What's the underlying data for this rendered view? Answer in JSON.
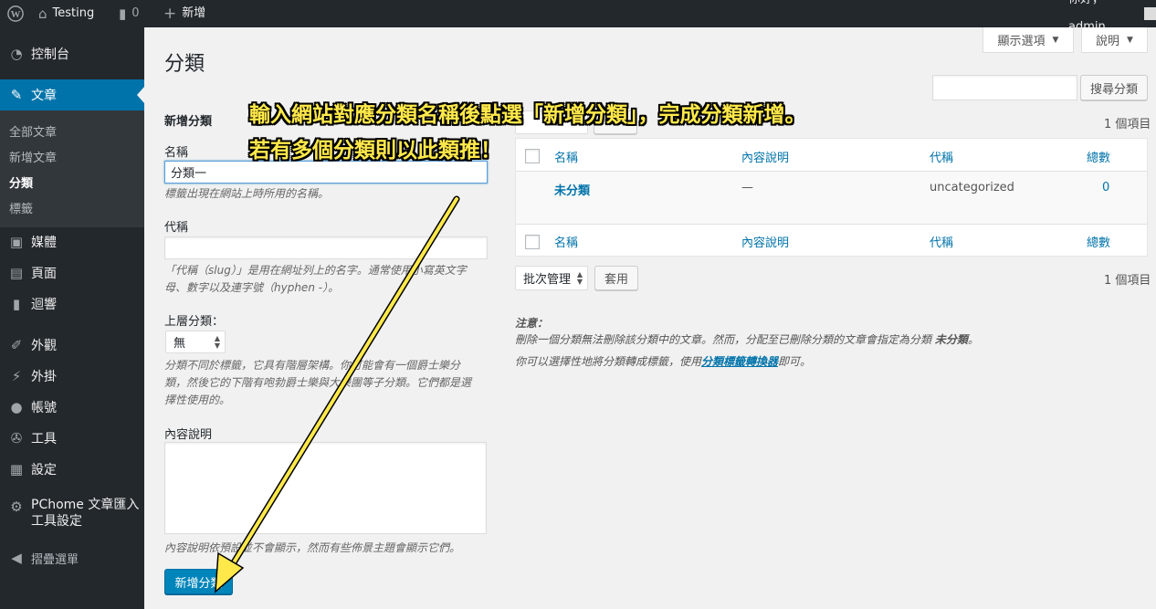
{
  "adminbar": {
    "site_name": "Testing",
    "comments_count": "0",
    "new_label": "新增",
    "greeting": "你好，admin"
  },
  "sidebar": {
    "items": [
      {
        "label": "控制台",
        "icon": "dashboard-icon"
      },
      {
        "label": "文章",
        "icon": "pin-icon"
      },
      {
        "label": "媒體",
        "icon": "media-icon"
      },
      {
        "label": "頁面",
        "icon": "page-icon"
      },
      {
        "label": "迴響",
        "icon": "comment-icon"
      },
      {
        "label": "外觀",
        "icon": "brush-icon"
      },
      {
        "label": "外掛",
        "icon": "plugin-icon"
      },
      {
        "label": "帳號",
        "icon": "user-icon"
      },
      {
        "label": "工具",
        "icon": "wrench-icon"
      },
      {
        "label": "設定",
        "icon": "settings-icon"
      },
      {
        "label": "PChome 文章匯入",
        "label2": "工具設定",
        "icon": "gear-icon"
      },
      {
        "label": "摺疊選單",
        "icon": "collapse-icon"
      }
    ],
    "submenu": [
      "全部文章",
      "新增文章",
      "分類",
      "標籤"
    ]
  },
  "screen_options": {
    "display_label": "顯示選項",
    "help_label": "說明"
  },
  "page_title": "分類",
  "search": {
    "value": "",
    "button_label": "搜尋分類"
  },
  "form": {
    "heading": "新增分類",
    "name_label": "名稱",
    "name_value": "分類一",
    "name_desc": "標籤出現在網站上時所用的名稱。",
    "slug_label": "代稱",
    "slug_value": "",
    "slug_desc_1": "「代稱（slug）」是用在網址列上的名字。通常使用小寫英文字",
    "slug_desc_2": "母、數字以及連字號（hyphen -）。",
    "parent_label": "上層分類：",
    "parent_value": "無",
    "parent_desc_1": "分類不同於標籤，它具有階層架構。你可能會有一個爵士樂分",
    "parent_desc_2": "類，然後它的下階有咆勃爵士樂與大樂團等子分類。它們都是選",
    "parent_desc_3": "擇性使用的。",
    "desc_label": "內容說明",
    "desc_value": "",
    "desc_desc": "內容說明依預設並不會顯示，然而有些佈景主題會顯示它們。",
    "submit_label": "新增分類"
  },
  "list": {
    "count_top": "1 個項目",
    "count_bottom": "1 個項目",
    "bulk_label": "批次管理",
    "apply_label": "套用",
    "columns": [
      "名稱",
      "內容說明",
      "代稱",
      "總數"
    ],
    "rows": [
      {
        "name": "未分類",
        "description": "—",
        "slug": "uncategorized",
        "count": "0"
      }
    ]
  },
  "notes": {
    "title": "注意：",
    "line1": "刪除一個分類無法刪除該分類中的文章。然而，分配至已刪除分類的文章會指定為分類",
    "line1_bold": "未分類",
    "line1_end": "。",
    "line2_pre": "你可以選擇性地將分類轉成標籤，使用",
    "line2_link": "分類標籤轉換器",
    "line2_post": "即可。"
  },
  "annotation": {
    "line1": "輸入網站對應分類名稱後點選「新增分類」，完成分類新增。",
    "line2": "若有多個分類則以此類推！",
    "color": "#ffe94a"
  }
}
